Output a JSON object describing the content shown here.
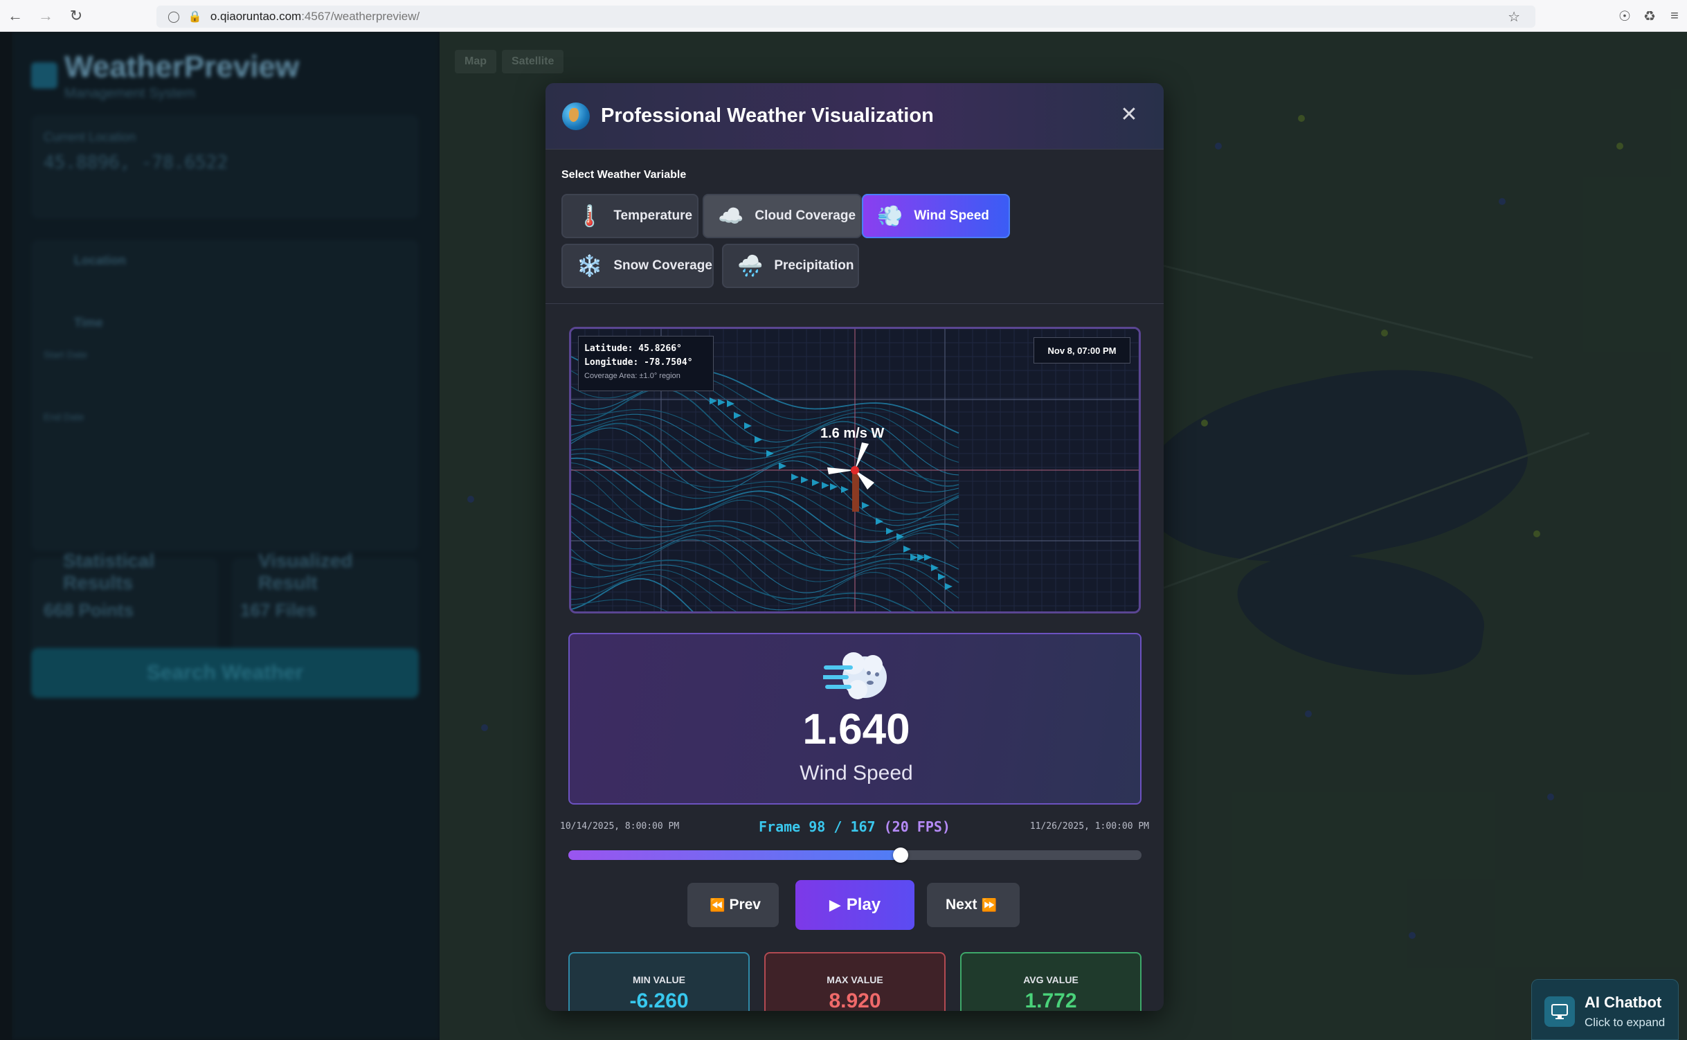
{
  "browser": {
    "url_host": "o.qiaoruntao.com",
    "url_rest": ":4567/weatherpreview/"
  },
  "background": {
    "brand": "WeatherPreview",
    "brand_sub": "Management System",
    "current_location_label": "Current Location",
    "current_coords": "45.8896, -78.6522",
    "location_section": "Location",
    "time_section": "Time",
    "start_label": "Start Date",
    "end_label": "End Date",
    "stat_left_title": "Statistical Results",
    "stat_left_value": "668 Points",
    "stat_right_title": "Visualized Result",
    "stat_right_value": "167 Files",
    "search_button": "Search Weather",
    "map_tabs": [
      "Map",
      "Satellite"
    ]
  },
  "modal": {
    "title": "Professional Weather Visualization",
    "close_glyph": "✕",
    "select_label": "Select Weather Variable",
    "variables": [
      {
        "label": "Temperature",
        "icon": "🌡️",
        "state": "normal"
      },
      {
        "label": "Cloud Coverage",
        "icon": "☁️",
        "state": "hover"
      },
      {
        "label": "Wind Speed",
        "icon": "💨",
        "state": "active"
      },
      {
        "label": "Snow Coverage",
        "icon": "❄️",
        "state": "normal"
      },
      {
        "label": "Precipitation",
        "icon": "🌧️",
        "state": "normal"
      }
    ],
    "canvas": {
      "latitude_text": "Latitude:  45.8266°",
      "longitude_text": "Longitude: -78.7504°",
      "coverage_text": "Coverage Area: ±1.0° region",
      "timestamp": "Nov 8, 07:00 PM",
      "speed_label": "1.6 m/s W"
    },
    "value_card": {
      "icon": "wind-face-icon",
      "value": "1.640",
      "caption": "Wind Speed"
    },
    "timeline": {
      "start": "10/14/2025, 8:00:00 PM",
      "end": "11/26/2025, 1:00:00 PM",
      "frame_text": "Frame 98 / 167",
      "fps_text": "(20 FPS)",
      "progress": 0.58
    },
    "controls": {
      "prev": "Prev",
      "play": "Play",
      "next": "Next"
    },
    "stats": [
      {
        "label": "MIN VALUE",
        "value": "-6.260",
        "color": "#38c8ee"
      },
      {
        "label": "MAX VALUE",
        "value": "8.920",
        "color": "#f06a6a"
      },
      {
        "label": "AVG VALUE",
        "value": "1.772",
        "color": "#4ad27a"
      }
    ]
  },
  "chatbot": {
    "title": "AI Chatbot",
    "subtitle": "Click to expand"
  },
  "colors": {
    "accent_purple": "#8a3ff0",
    "accent_blue": "#3b5cf5",
    "frame_cyan": "#3ac8ee"
  }
}
